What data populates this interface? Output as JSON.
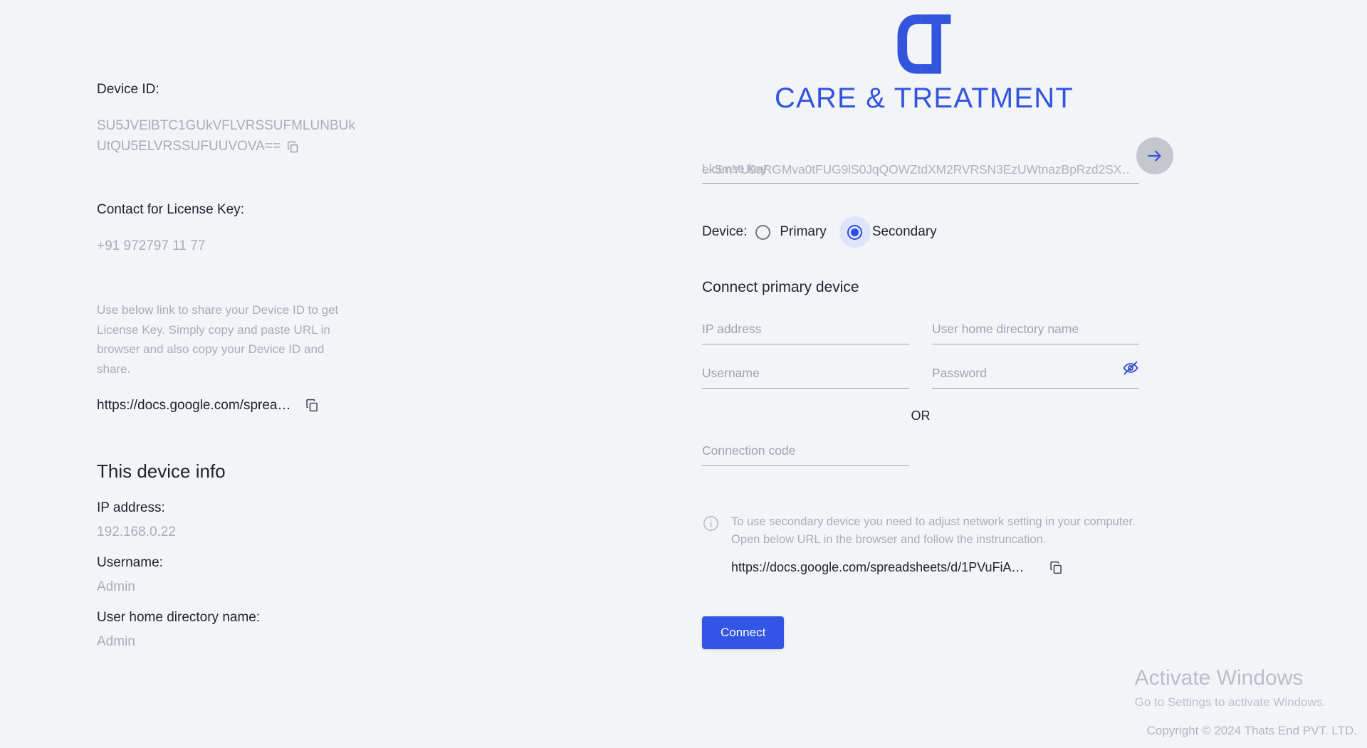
{
  "brand": {
    "logo_mark": "ct-monogram",
    "wordmark": "CARE & TREATMENT",
    "accent_color": "#3355dd",
    "button_color": "#3355e5"
  },
  "left": {
    "device_id_label": "Device ID:",
    "device_id_value": "SU5JVElBTC1GUkVFLVRSSUFMLUNBUkUtQU5ELVRSSUFUUVOVA==",
    "copy_device_id_icon": "copy-icon",
    "contact_label": "Contact for License Key:",
    "contact_value": "+91 972797 11 77",
    "help_text": "Use below link to share your Device ID to get License Key. Simply copy and paste URL in browser and also copy your Device ID and share.",
    "share_url": "https://docs.google.com/sprea…",
    "copy_share_url_icon": "copy-icon",
    "device_info_heading": "This device info",
    "info_rows": [
      {
        "label": "IP address:",
        "value": "192.168.0.22"
      },
      {
        "label": "Username:",
        "value": "Admin"
      },
      {
        "label": "User home directory name:",
        "value": "Admin"
      }
    ]
  },
  "right": {
    "license_key_value": "ek5mYU9aRGMva0tFUG9lS0JqQOWZtdXM2RVRSN3EzUWtnazBpRzd2SX…",
    "license_key_placeholder": "License key",
    "submit_license_icon": "arrow-right-icon",
    "device_label": "Device:",
    "device_options": [
      {
        "label": "Primary",
        "selected": false
      },
      {
        "label": "Secondary",
        "selected": true
      }
    ],
    "connect_heading": "Connect primary device",
    "fields": [
      {
        "name": "ip-address",
        "placeholder": "IP address",
        "value": ""
      },
      {
        "name": "user-home-directory-name",
        "placeholder": "User home directory name",
        "value": ""
      },
      {
        "name": "username",
        "placeholder": "Username",
        "value": ""
      },
      {
        "name": "password",
        "placeholder": "Password",
        "value": ""
      }
    ],
    "password_toggle_icon": "eye-off-icon",
    "or_text": "OR",
    "connection_code_placeholder": "Connection code",
    "connection_code_value": "",
    "info_icon": "info-icon",
    "info_text": "To use secondary device you need to adjust network setting in your computer. Open below URL in the browser and follow the instruncation.",
    "note_url": "https://docs.google.com/spreadsheets/d/1PVuFiAwVw…",
    "copy_note_url_icon": "copy-icon",
    "connect_button": "Connect"
  },
  "watermark": {
    "title": "Activate Windows",
    "subtitle": "Go to Settings to activate Windows."
  },
  "footer": {
    "copyright": "Copyright © 2024 Thats End PVT. LTD."
  }
}
